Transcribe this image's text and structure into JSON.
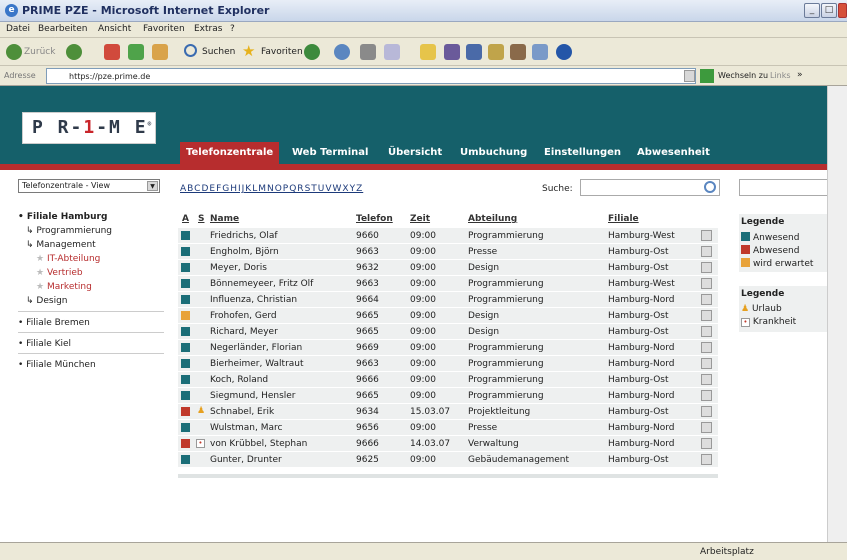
{
  "window": {
    "title": "PRIME PZE - Microsoft Internet Explorer"
  },
  "menu": [
    "Datei",
    "Bearbeiten",
    "Ansicht",
    "Favoriten",
    "Extras",
    "?"
  ],
  "toolbar": {
    "back": "Zurück",
    "search": "Suchen",
    "favorites": "Favoriten"
  },
  "address": {
    "label": "Adresse",
    "url": "https://pze.prime.de",
    "go": "Wechseln zu",
    "links": "Links",
    "more": "»"
  },
  "logo": {
    "pre": "P R-",
    "mid": "1",
    "post": "-M E",
    "reg": "®"
  },
  "tabs": [
    "Telefonzentrale",
    "Web Terminal",
    "Übersicht",
    "Umbuchung",
    "Einstellungen",
    "Abwesenheit"
  ],
  "view_select": "Telefonzentrale - View",
  "alphabet": "ABCDEFGHIJKLMNOPQRSTUVWXYZ",
  "search_label": "Suche:",
  "sidebar": {
    "branch_hamburg": "Filiale Hamburg",
    "programmierung": "Programmierung",
    "management": "Management",
    "it": "IT-Abteilung",
    "vertrieb": "Vertrieb",
    "marketing": "Marketing",
    "design": "Design",
    "bremen": "Filiale Bremen",
    "kiel": "Filiale Kiel",
    "muenchen": "Filiale München"
  },
  "table": {
    "headers": {
      "a": "A",
      "s": "S",
      "name": "Name",
      "tel": "Telefon",
      "zeit": "Zeit",
      "abt": "Abteilung",
      "fil": "Filiale"
    },
    "rows": [
      {
        "status": "#1b6e78",
        "s": "",
        "name": "Friedrichs, Olaf",
        "tel": "9660",
        "zeit": "09:00",
        "abt": "Programmierung",
        "fil": "Hamburg-West"
      },
      {
        "status": "#1b6e78",
        "s": "",
        "name": "Engholm, Björn",
        "tel": "9663",
        "zeit": "09:00",
        "abt": "Presse",
        "fil": "Hamburg-Ost"
      },
      {
        "status": "#1b6e78",
        "s": "",
        "name": "Meyer, Doris",
        "tel": "9632",
        "zeit": "09:00",
        "abt": "Design",
        "fil": "Hamburg-Ost"
      },
      {
        "status": "#1b6e78",
        "s": "",
        "name": "Bönnemeyeer, Fritz Olf",
        "tel": "9663",
        "zeit": "09:00",
        "abt": "Programmierung",
        "fil": "Hamburg-West"
      },
      {
        "status": "#1b6e78",
        "s": "",
        "name": "Influenza, Christian",
        "tel": "9664",
        "zeit": "09:00",
        "abt": "Programmierung",
        "fil": "Hamburg-Nord"
      },
      {
        "status": "#e8a23a",
        "s": "",
        "name": "Frohofen, Gerd",
        "tel": "9665",
        "zeit": "09:00",
        "abt": "Design",
        "fil": "Hamburg-Ost"
      },
      {
        "status": "#1b6e78",
        "s": "",
        "name": "Richard, Meyer",
        "tel": "9665",
        "zeit": "09:00",
        "abt": "Design",
        "fil": "Hamburg-Ost"
      },
      {
        "status": "#1b6e78",
        "s": "",
        "name": "Negerländer, Florian",
        "tel": "9669",
        "zeit": "09:00",
        "abt": "Programmierung",
        "fil": "Hamburg-Nord"
      },
      {
        "status": "#1b6e78",
        "s": "",
        "name": "Bierheimer, Waltraut",
        "tel": "9663",
        "zeit": "09:00",
        "abt": "Programmierung",
        "fil": "Hamburg-Nord"
      },
      {
        "status": "#1b6e78",
        "s": "",
        "name": "Koch, Roland",
        "tel": "9666",
        "zeit": "09:00",
        "abt": "Programmierung",
        "fil": "Hamburg-Ost"
      },
      {
        "status": "#1b6e78",
        "s": "",
        "name": "Siegmund, Hensler",
        "tel": "9665",
        "zeit": "09:00",
        "abt": "Programmierung",
        "fil": "Hamburg-Nord"
      },
      {
        "status": "#c0392b",
        "s": "urlaub",
        "name": "Schnabel, Erik",
        "tel": "9634",
        "zeit": "15.03.07",
        "abt": "Projektleitung",
        "fil": "Hamburg-Ost"
      },
      {
        "status": "#1b6e78",
        "s": "",
        "name": "Wulstman, Marc",
        "tel": "9656",
        "zeit": "09:00",
        "abt": "Presse",
        "fil": "Hamburg-Nord"
      },
      {
        "status": "#c0392b",
        "s": "krank",
        "name": "von Krübbel, Stephan",
        "tel": "9666",
        "zeit": "14.03.07",
        "abt": "Verwaltung",
        "fil": "Hamburg-Nord"
      },
      {
        "status": "#1b6e78",
        "s": "",
        "name": "Gunter, Drunter",
        "tel": "9625",
        "zeit": "09:00",
        "abt": "Gebäudemanagement",
        "fil": "Hamburg-Ost"
      }
    ]
  },
  "legend1": {
    "title": "Legende",
    "items": [
      {
        "color": "#1b6e78",
        "label": "Anwesend"
      },
      {
        "color": "#c0392b",
        "label": "Abwesend"
      },
      {
        "color": "#e8a23a",
        "label": "wird erwartet"
      }
    ]
  },
  "legend2": {
    "title": "Legende",
    "urlaub": "Urlaub",
    "krank": "Krankheit"
  },
  "status": {
    "zone": "Arbeitsplatz"
  }
}
